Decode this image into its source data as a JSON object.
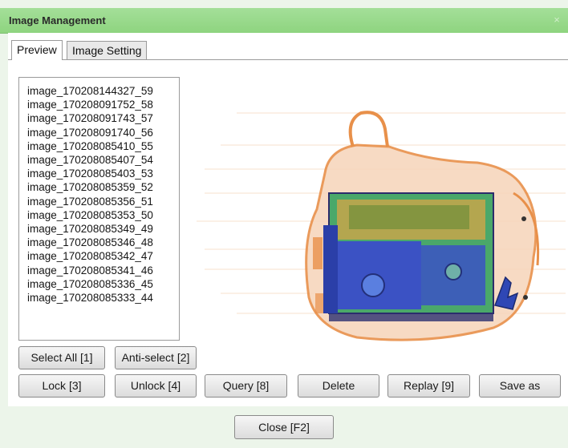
{
  "window": {
    "title": "Image Management",
    "close_glyph": "×"
  },
  "tabs": [
    {
      "label": "Preview"
    },
    {
      "label": "Image Setting"
    }
  ],
  "image_list": [
    "image_170208144327_59",
    "image_170208091752_58",
    "image_170208091743_57",
    "image_170208091740_56",
    "image_170208085410_55",
    "image_170208085407_54",
    "image_170208085403_53",
    "image_170208085359_52",
    "image_170208085356_51",
    "image_170208085353_50",
    "image_170208085349_49",
    "image_170208085346_48",
    "image_170208085342_47",
    "image_170208085341_46",
    "image_170208085336_45",
    "image_170208085333_44"
  ],
  "buttons": {
    "select_all": "Select All [1]",
    "anti_select": "Anti-select [2]",
    "lock": "Lock [3]",
    "unlock": "Unlock [4]",
    "query": "Query [8]",
    "delete": "Delete",
    "replay": "Replay [9]",
    "save_as": "Save as",
    "close": "Close [F2]"
  },
  "colors": {
    "titlebar": "#9bdb8e",
    "xray_orange": "#e8904a",
    "xray_blue": "#3b52c4",
    "xray_green": "#4aa86a"
  }
}
